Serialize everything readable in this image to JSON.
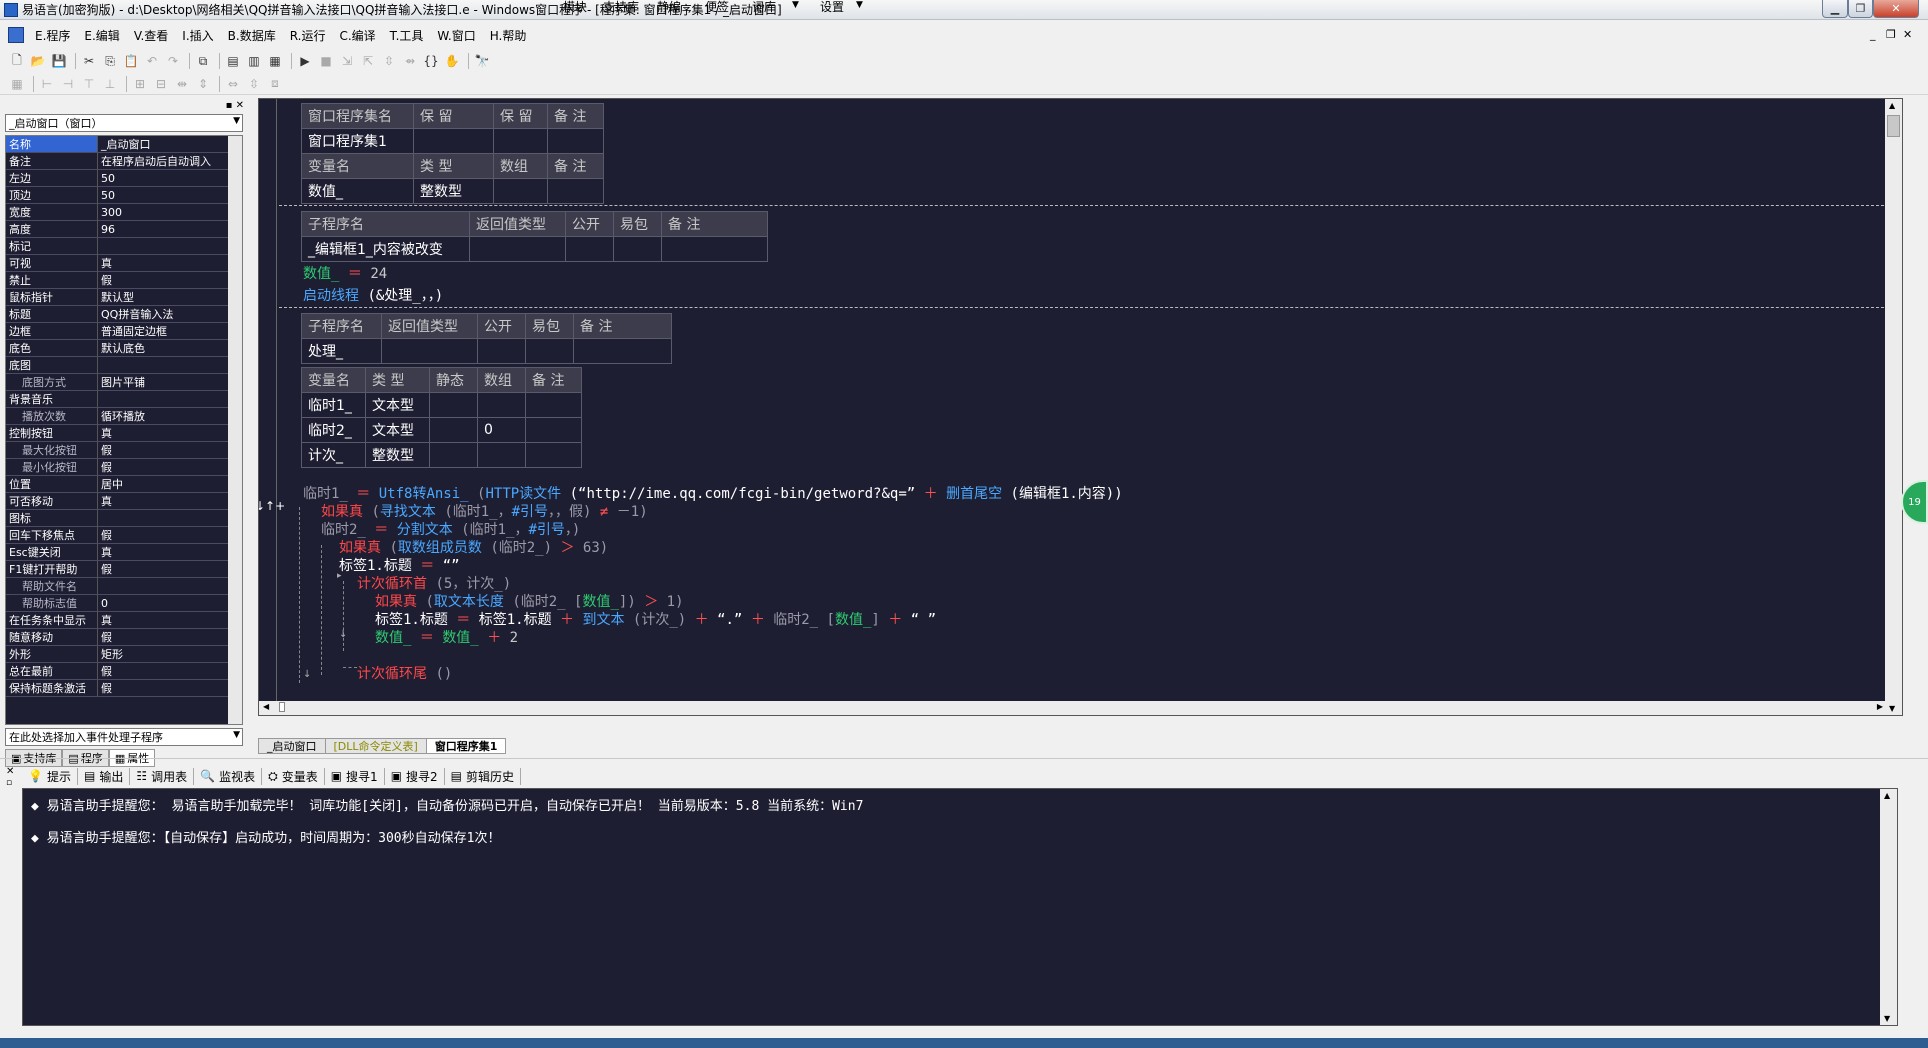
{
  "window": {
    "title": "易语言(加密狗版) - d:\\Desktop\\网络相关\\QQ拼音输入法接口\\QQ拼音输入法接口.e - Windows窗口程序 - [程序集: 窗口程序集1 / _启动窗口]"
  },
  "menu": {
    "items": [
      "E.程序",
      "E.编辑",
      "V.查看",
      "I.插入",
      "B.数据库",
      "R.运行",
      "C.编译",
      "T.工具",
      "W.窗口",
      "H.帮助"
    ],
    "right": [
      "模块",
      "支持库",
      "静编",
      "便签",
      "词库",
      "设置"
    ]
  },
  "left_panel": {
    "object_combo": "_启动窗口（窗口）",
    "properties": [
      {
        "k": "名称",
        "v": "_启动窗口",
        "sel": true
      },
      {
        "k": "备注",
        "v": "在程序启动后自动调入"
      },
      {
        "k": "左边",
        "v": "50"
      },
      {
        "k": "顶边",
        "v": "50"
      },
      {
        "k": "宽度",
        "v": "300"
      },
      {
        "k": "高度",
        "v": "96"
      },
      {
        "k": "标记",
        "v": ""
      },
      {
        "k": "可视",
        "v": "真"
      },
      {
        "k": "禁止",
        "v": "假"
      },
      {
        "k": "鼠标指针",
        "v": "默认型"
      },
      {
        "k": "标题",
        "v": "QQ拼音输入法"
      },
      {
        "k": "边框",
        "v": "普通固定边框"
      },
      {
        "k": "底色",
        "v": "默认底色"
      },
      {
        "k": "底图",
        "v": ""
      },
      {
        "k": "底图方式",
        "v": "图片平铺",
        "sub": true
      },
      {
        "k": "背景音乐",
        "v": ""
      },
      {
        "k": "播放次数",
        "v": "循环播放",
        "sub": true
      },
      {
        "k": "控制按钮",
        "v": "真"
      },
      {
        "k": "最大化按钮",
        "v": "假",
        "sub": true
      },
      {
        "k": "最小化按钮",
        "v": "假",
        "sub": true
      },
      {
        "k": "位置",
        "v": "居中"
      },
      {
        "k": "可否移动",
        "v": "真"
      },
      {
        "k": "图标",
        "v": ""
      },
      {
        "k": "回车下移焦点",
        "v": "假"
      },
      {
        "k": "Esc键关闭",
        "v": "真"
      },
      {
        "k": "F1键打开帮助",
        "v": "假"
      },
      {
        "k": "帮助文件名",
        "v": "",
        "sub": true
      },
      {
        "k": "帮助标志值",
        "v": "0",
        "sub": true
      },
      {
        "k": "在任务条中显示",
        "v": "真"
      },
      {
        "k": "随意移动",
        "v": "假"
      },
      {
        "k": "外形",
        "v": "矩形"
      },
      {
        "k": "总在最前",
        "v": "假"
      },
      {
        "k": "保持标题条激活",
        "v": "假"
      }
    ],
    "event_combo": "在此处选择加入事件处理子程序",
    "tabs": [
      "支持库",
      "程序",
      "属性"
    ]
  },
  "editor": {
    "assembly_header": [
      "窗口程序集名",
      "保 留",
      "保 留",
      "备 注"
    ],
    "assembly_row": [
      "窗口程序集1",
      "",
      "",
      ""
    ],
    "var_header": [
      "变量名",
      "类 型",
      "数组",
      "备 注"
    ],
    "var_row": [
      "数值_",
      "整数型",
      "",
      ""
    ],
    "sub1_header": [
      "子程序名",
      "返回值类型",
      "公开",
      "易包",
      "备 注"
    ],
    "sub1_row": [
      "_编辑框1_内容被改变",
      "",
      "",
      "",
      ""
    ],
    "code1": {
      "a": "数值_",
      "b": "＝",
      "c": "24"
    },
    "code2": {
      "a": "启动线程",
      "b": "(&处理_，，)"
    },
    "sub2_header": [
      "子程序名",
      "返回值类型",
      "公开",
      "易包",
      "备 注"
    ],
    "sub2_row": [
      "处理_",
      "",
      "",
      "",
      ""
    ],
    "local_header": [
      "变量名",
      "类 型",
      "静态",
      "数组",
      "备 注"
    ],
    "locals": [
      [
        "临时1_",
        "文本型",
        "",
        "",
        ""
      ],
      [
        "临时2_",
        "文本型",
        "",
        "0",
        ""
      ],
      [
        "计次_",
        "整数型",
        "",
        "",
        ""
      ]
    ],
    "lines": {
      "l1a": "临时1_",
      "l1b": "＝",
      "l1c": "Utf8转Ansi_",
      "l1d": "(",
      "l1e": "HTTP读文件",
      "l1f": "(“http://ime.qq.com/fcgi-bin/getword?&q=”",
      "l1g": "＋",
      "l1h": "删首尾空",
      "l1i": "(编辑框1.内容))",
      "l2a": "如果真",
      "l2b": "(",
      "l2c": "寻找文本",
      "l2d": "(临时1_，",
      "l2e": "#引号",
      "l2f": "，，假)",
      "l2g": "≠",
      "l2h": "－1)",
      "l3a": "临时2_",
      "l3b": "＝",
      "l3c": "分割文本",
      "l3d": "(临时1_，",
      "l3e": "#引号",
      "l3f": "，)",
      "l4a": "如果真",
      "l4b": "(",
      "l4c": "取数组成员数",
      "l4d": "(临时2_)",
      "l4e": "＞",
      "l4f": "63)",
      "l5a": "标签1.标题",
      "l5b": "＝",
      "l5c": "“”",
      "l6a": "计次循环首",
      "l6b": "(5，计次_)",
      "l7a": "如果真",
      "l7b": "(",
      "l7c": "取文本长度",
      "l7d": "(临时2_ [",
      "l7e": "数值_",
      "l7f": "])",
      "l7g": "＞",
      "l7h": "1)",
      "l8a": "标签1.标题",
      "l8b": "＝",
      "l8c": "标签1.标题",
      "l8d": "＋",
      "l8e": "到文本",
      "l8f": "(计次_)",
      "l8g": "＋",
      "l8h": "“.”",
      "l8i": "＋",
      "l8j": "临时2_ [",
      "l8k": "数值_",
      "l8l": "]",
      "l8m": "＋",
      "l8n": "“ ”",
      "l9a": "数值_",
      "l9b": "＝",
      "l9c": "数值_",
      "l9d": "＋",
      "l9e": "2",
      "l10a": "计次循环尾",
      "l10b": "()"
    },
    "tabs": [
      "_启动窗口",
      "[DLL命令定义表]",
      "窗口程序集1"
    ]
  },
  "bottom": {
    "tabs": [
      "提示",
      "输出",
      "调用表",
      "监视表",
      "变量表",
      "搜寻1",
      "搜寻2",
      "剪辑历史"
    ],
    "messages": [
      "◆ 易语言助手提醒您： 易语言助手加载完毕！ 词库功能[关闭]，自动备份源码已开启，自动保存已开启！ 当前易版本：5.8  当前系统：Win7",
      "◆ 易语言助手提醒您：【自动保存】启动成功，时间周期为：300秒自动保存1次！"
    ]
  },
  "green_button": "19"
}
